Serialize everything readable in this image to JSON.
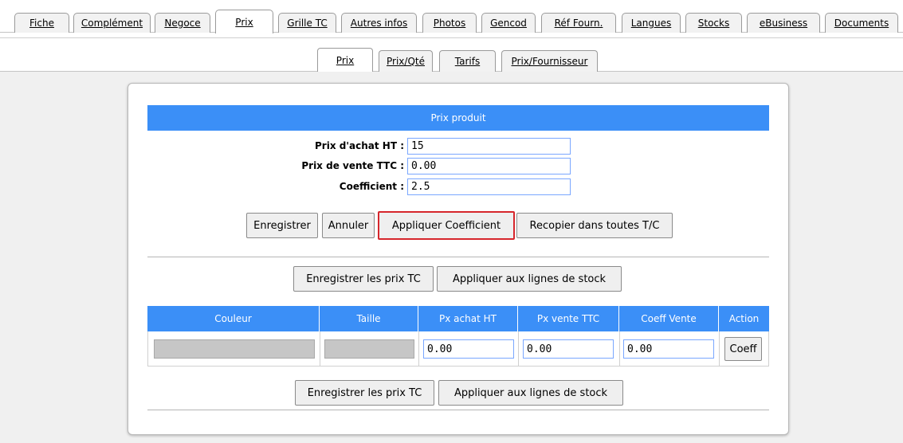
{
  "top_tabs": [
    {
      "label": "Fiche",
      "active": false
    },
    {
      "label": "Complément",
      "active": false
    },
    {
      "label": "Negoce",
      "active": false
    },
    {
      "label": "Prix",
      "active": true
    },
    {
      "label": "Grille TC",
      "active": false
    },
    {
      "label": "Autres infos",
      "active": false
    },
    {
      "label": "Photos",
      "active": false
    },
    {
      "label": "Gencod",
      "active": false
    },
    {
      "label": "Réf Fourn.",
      "active": false
    },
    {
      "label": "Langues",
      "active": false
    },
    {
      "label": "Stocks",
      "active": false
    },
    {
      "label": "eBusiness",
      "active": false
    },
    {
      "label": "Documents",
      "active": false
    }
  ],
  "sub_tabs": [
    {
      "label": "Prix",
      "active": true
    },
    {
      "label": "Prix/Qté",
      "active": false
    },
    {
      "label": "Tarifs",
      "active": false
    },
    {
      "label": "Prix/Fournisseur",
      "active": false
    }
  ],
  "section": {
    "title": "Prix produit"
  },
  "form": {
    "purchase_price": {
      "label": "Prix d'achat HT :",
      "value": "15"
    },
    "sale_price": {
      "label": "Prix de vente TTC :",
      "value": "0.00"
    },
    "coefficient": {
      "label": "Coefficient :",
      "value": "2.5"
    }
  },
  "buttons": {
    "save": "Enregistrer",
    "cancel": "Annuler",
    "apply_coeff": "Appliquer Coefficient",
    "copy_all": "Recopier dans toutes T/C",
    "save_tc_prices": "Enregistrer les prix TC",
    "apply_stock_lines": "Appliquer aux lignes de stock"
  },
  "table": {
    "columns": [
      "Couleur",
      "Taille",
      "Px achat HT",
      "Px vente TTC",
      "Coeff Vente",
      "Action"
    ],
    "rows": [
      {
        "couleur": "",
        "taille": "",
        "px_achat": "0.00",
        "px_vente": "0.00",
        "coeff": "0.00",
        "action": "Coeff"
      }
    ]
  },
  "colors": {
    "header_blue": "#3b8ff7",
    "highlight_red": "#d6262c"
  }
}
